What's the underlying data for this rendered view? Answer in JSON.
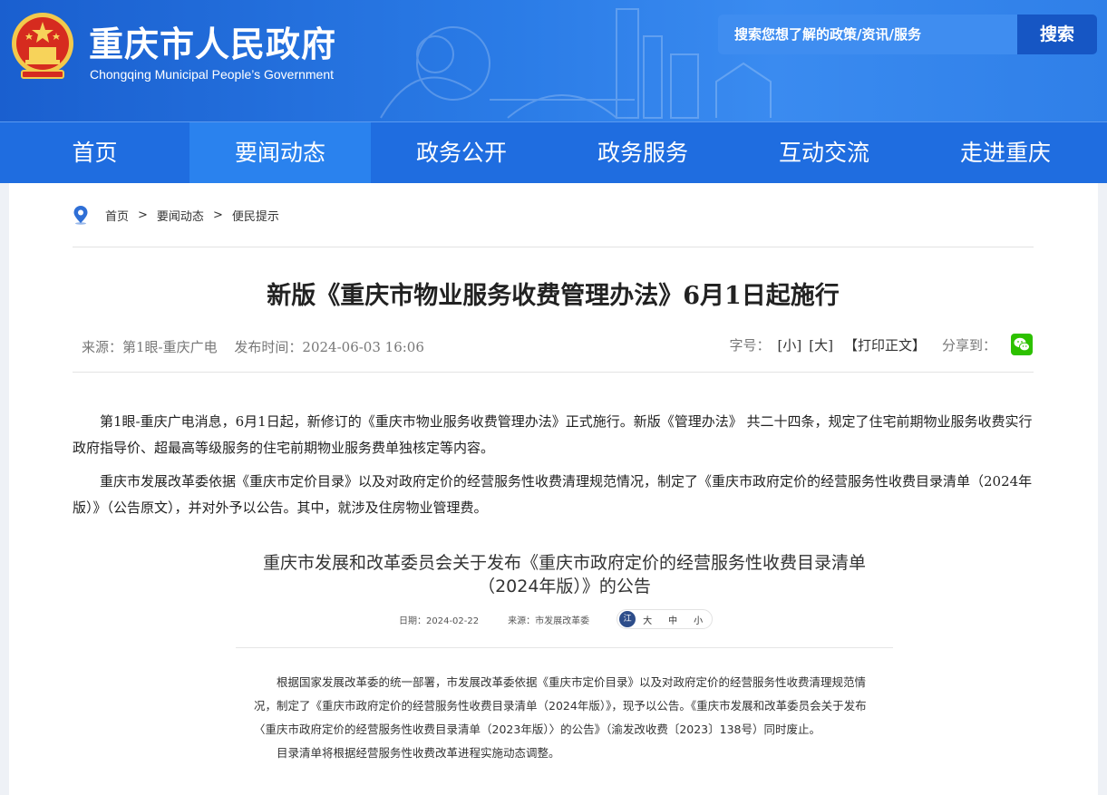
{
  "header": {
    "site_title": "重庆市人民政府",
    "site_subtitle": "Chongqing Municipal People’s Government",
    "search_placeholder": "搜索您想了解的政策/资讯/服务",
    "search_button": "搜索",
    "colors": {
      "header_blue": "#2a7be6",
      "nav_blue": "#1f6de0",
      "active_nav": "#2a82ee"
    }
  },
  "nav": {
    "items": [
      {
        "label": "首页",
        "active": false
      },
      {
        "label": "要闻动态",
        "active": true
      },
      {
        "label": "政务公开",
        "active": false
      },
      {
        "label": "政务服务",
        "active": false
      },
      {
        "label": "互动交流",
        "active": false
      },
      {
        "label": "走进重庆",
        "active": false
      }
    ]
  },
  "breadcrumb": {
    "items": [
      "首页",
      "要闻动态",
      "便民提示"
    ],
    "separator": ">"
  },
  "article": {
    "title": "新版《重庆市物业服务收费管理办法》6月1日起施行",
    "source": "来源：第1眼-重庆广电",
    "publish_time": "发布时间：2024-06-03 16:06",
    "font_size_label": "字号：",
    "small": "[小]",
    "large": "[大]",
    "print": "【打印正文】",
    "share_label": "分享到：",
    "paragraphs": [
      "第1眼-重庆广电消息，6月1日起，新修订的《重庆市物业服务收费管理办法》正式施行。新版《管理办法》 共二十四条，规定了住宅前期物业服务收费实行政府指导价、超最高等级服务的住宅前期物业服务费单独核定等内容。",
      "重庆市发展改革委依据《重庆市定价目录》以及对政府定价的经营服务性收费清理规范情况，制定了《重庆市政府定价的经营服务性收费目录清单（2024年版）》（公告原文），并对外予以公告。其中，就涉及住房物业管理费。"
    ]
  },
  "notice": {
    "title_line1": "重庆市发展和改革委员会关于发布《重庆市政府定价的经营服务性收费目录清单",
    "title_line2": "（2024年版）》的公告",
    "date": "日期：2024-02-22",
    "source": "来源：市发展改革委",
    "badge": "江",
    "size_options": [
      "大",
      "中",
      "小"
    ],
    "body": [
      "根据国家发展改革委的统一部署，市发展改革委依据《重庆市定价目录》以及对政府定价的经营服务性收费清理规范情况，制定了《重庆市政府定价的经营服务性收费目录清单（2024年版）》，现予以公告。《重庆市发展和改革委员会关于发布〈重庆市政府定价的经营服务性收费目录清单（2023年版）〉的公告》（渝发改收费〔2023〕138号）同时废止。",
      "目录清单将根据经营服务性收费改革进程实施动态调整。"
    ]
  }
}
